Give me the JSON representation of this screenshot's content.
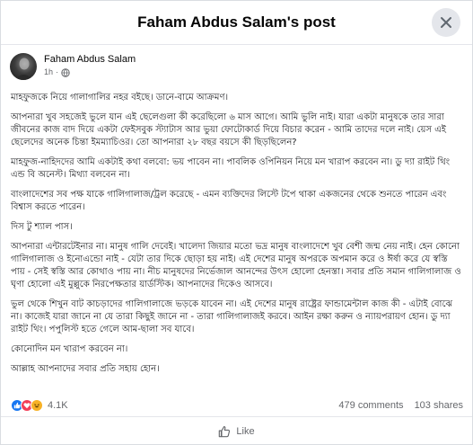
{
  "header": {
    "title": "Faham Abdus Salam's post",
    "close_icon": "close-icon"
  },
  "author": {
    "name": "Faham Abdus Salam",
    "time": "1h",
    "separator": "·",
    "audience_icon": "globe-icon"
  },
  "post": {
    "paragraphs": [
      "মাহফুজকে নিয়ে গালাগালির নহর বইছে। ডানে-বামে আক্রমণ।",
      "আপনারা খুব সহজেই ভুলে যান এই ছেলেগুলা কী করেছিলো ৬ মাস আগে। আমি ভুলি নাই। যারা একটা মানুষকে তার সারা জীবনের কাজ বাদ দিয়ে একটা ফেইসবুক স্ট্যাটাস আর ভুয়া ফোটোকার্ড দিয়ে বিচার করেন - আমি তাদের দলে নাই। য়েস এই ছেলেদের অনেক চিন্তা ইমম্যাচিওর। তো আপনারা ২৮ বছর বয়সে কী ছিড়ছিলেন?",
      "মাহফুজ-নাহিদদের আমি একটাই কথা বলবো: ভয় পাবেন না। পাবলিক ওপিনিয়ন নিয়ে মন খারাপ করবেন না। ডু দ্যা রাইট থিং এন্ড বি অনেস্ট। মিথ্যা বলবেন না।",
      "বাংলাদেশের সব পক্ষ যাকে গালিগালাজ/ট্রল করেছে - এমন ব্যক্তিদের লিস্টে টপে থাকা একজনের থেকে শুনতে পারেন এবং বিশ্বাস করতে পারেন।",
      "দিস টু শ্যাল পাস।",
      "আপনারা এন্টারটেইনার না। মানুষ গালি দেবেই। খালেদা জিয়ার মতো ভদ্র মানুষ বাংলাদেশে খুব বেশী জন্ম নেয় নাই। হেন কোনো গালিগালাজ ও ইনোএন্ডো নাই - যেটা তার দিকে ছোড়া হয় নাই। এই দেশের মানুষ অপরকে অপমান করে ও ঈর্ষা করে যে স্বস্তি পায় - সেই স্বস্তি আর কোথাও পায় না। নীচ মানুষদের নির্ভেজাল আনন্দের উৎস হোলো হেনস্তা। সবার প্রতি সমান গালিগালাজ ও ঘৃণা হোলো এই মুল্লুকে নিরপেক্ষতার য়ার্ডস্টিক। আপনাদের দিকেও আসবে।",
      "ভুল থেকে শিখুন বাট কাচড়াদের গালিগালাজে ভড়কে যাবেন না। এই দেশের মানুষ রাষ্ট্রের ফান্ডামেন্টাল কাজ কী - এটাই বোঝে না। কাজেই যারা জানে না যে তারা কিছুই জানে না - তারা গালিগালাজই করবে। আইন রক্ষা করুন ও ন্যায়পরায়ণ হোন। ডু দ্যা রাইট থিং। পপুলিস্ট হতে গেলে আম-ছালা সব যাবে।",
      "কোনোদিন মন খারাপ করবেন না।",
      "আল্লাহ আপনাদের সবার প্রতি সহায় হোন।"
    ]
  },
  "stats": {
    "reactions": [
      "like",
      "love",
      "haha"
    ],
    "reaction_count": "4.1K",
    "comments": "479 comments",
    "shares": "103 shares"
  },
  "actions": {
    "like_label": "Like",
    "like_icon": "thumbs-up-icon"
  },
  "colors": {
    "like": "#1877f2",
    "love": "#f33e58",
    "haha": "#f7b125",
    "muted": "#65676b"
  }
}
